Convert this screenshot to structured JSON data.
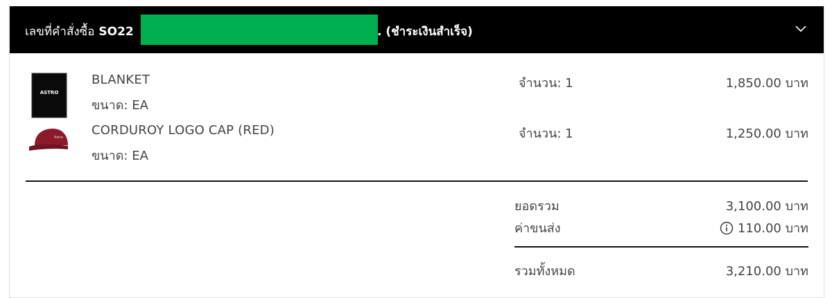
{
  "header": {
    "prefix": "เลขที่คำสั่งซื้อ",
    "order_no": "SO22",
    "status": ". (ชำระเงินสำเร็จ)"
  },
  "items": [
    {
      "name": "BLANKET",
      "size": "ขนาด: EA",
      "qty": "จำนวน: 1",
      "price": "1,850.00 บาท",
      "thumb_text": "ASTRO"
    },
    {
      "name": "CORDUROY LOGO CAP (RED)",
      "size": "ขนาด: EA",
      "qty": "จำนวน: 1",
      "price": "1,250.00 บาท"
    }
  ],
  "summary": {
    "subtotal_label": "ยอดรวม",
    "subtotal_value": "3,100.00 บาท",
    "shipping_label": "ค่าขนส่ง",
    "shipping_value": "110.00 บาท",
    "total_label": "รวมทั้งหมด",
    "total_value": "3,210.00 บาท"
  },
  "colors": {
    "header_bg": "#000000",
    "redaction": "#00b050",
    "cap": "#8b1a2b"
  }
}
